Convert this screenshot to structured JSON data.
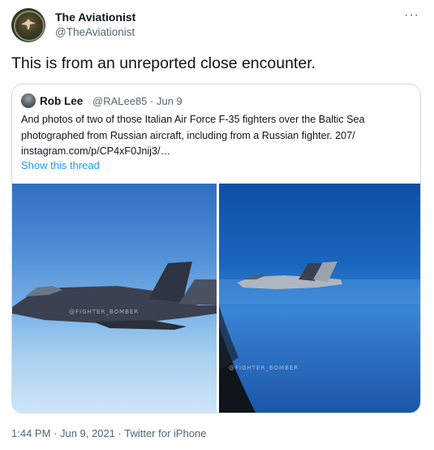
{
  "tweet": {
    "author": {
      "name": "The Aviationist",
      "handle": "@TheAviationist"
    },
    "more_icon": "more-horizontal-icon",
    "text": "This is from an unreported close encounter.",
    "footer": "1:44 PM · Jun 9, 2021 · Twitter for iPhone"
  },
  "quoted_tweet": {
    "author": {
      "name": "Rob Lee",
      "handle": "@RALee85"
    },
    "meta": "@RALee85 · Jun 9",
    "text_lines": [
      "And photos of two of those Italian Air Force F-35 fighters over the Baltic Sea",
      "photographed from Russian aircraft, including from a Russian fighter. 207/",
      "instagram.com/p/CP4xF0Jnij3/…"
    ],
    "show_thread": "Show this thread",
    "photos": [
      {
        "watermark": "@FIGHTER_BOMBER"
      },
      {
        "watermark": "@FIGHTER_BOMBER"
      }
    ]
  },
  "colors": {
    "link": "#1d9bf0",
    "secondary_text": "#536471",
    "border": "#cfd9de"
  }
}
